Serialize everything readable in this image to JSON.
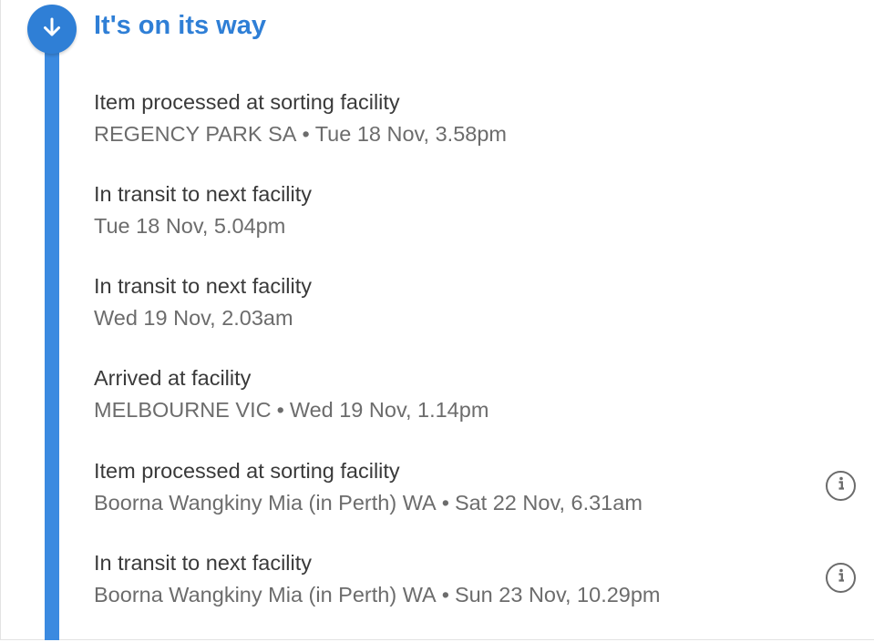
{
  "status": {
    "title": "It's on its way",
    "icon": "arrow-down-icon",
    "accent_color": "#2f7fd6"
  },
  "events": [
    {
      "title": "Item processed at sorting facility",
      "location": "REGENCY PARK SA",
      "separator": "•",
      "datetime": "Tue 18 Nov, 3.58pm",
      "has_info": false
    },
    {
      "title": "In transit to next facility",
      "location": "",
      "separator": "",
      "datetime": "Tue 18 Nov, 5.04pm",
      "has_info": false
    },
    {
      "title": "In transit to next facility",
      "location": "",
      "separator": "",
      "datetime": "Wed 19 Nov, 2.03am",
      "has_info": false
    },
    {
      "title": "Arrived at facility",
      "location": "MELBOURNE VIC",
      "separator": "•",
      "datetime": "Wed 19 Nov, 1.14pm",
      "has_info": false
    },
    {
      "title": "Item processed at sorting facility",
      "location": "Boorna Wangkiny Mia (in Perth) WA",
      "separator": "•",
      "datetime": "Sat 22 Nov, 6.31am",
      "has_info": true
    },
    {
      "title": "In transit to next facility",
      "location": "Boorna Wangkiny Mia (in Perth) WA",
      "separator": "•",
      "datetime": "Sun 23 Nov, 10.29pm",
      "has_info": true
    }
  ]
}
